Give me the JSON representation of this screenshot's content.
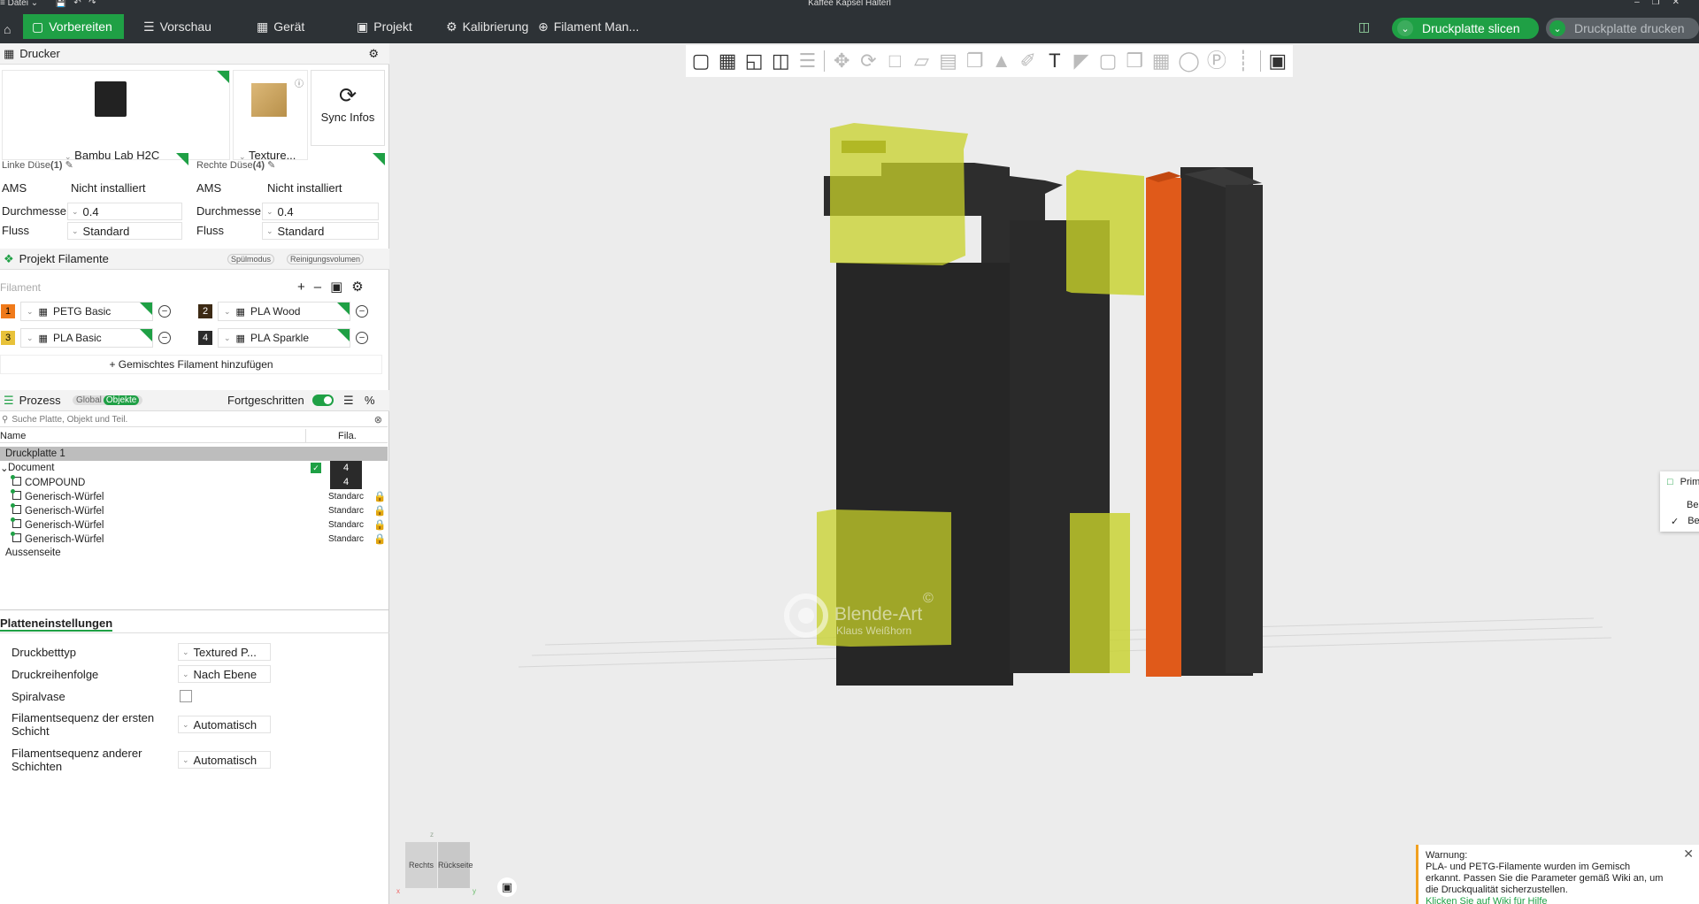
{
  "window": {
    "title": "Kaffee Kapsel Halterl",
    "menu_label": "Datei"
  },
  "topbar": {
    "tabs": [
      {
        "label": "Vorbereiten"
      },
      {
        "label": "Vorschau"
      },
      {
        "label": "Gerät"
      },
      {
        "label": "Projekt"
      },
      {
        "label": "Kalibrierung"
      },
      {
        "label": "Filament Man..."
      }
    ],
    "slice_label": "Druckplatte slicen",
    "print_label": "Druckplatte drucken"
  },
  "printer": {
    "section_title": "Drucker",
    "printer_name": "Bambu Lab H2C",
    "plate_name": "Texture...",
    "sync_label": "Sync Infos",
    "left_nozzle": {
      "title": "Linke Düse",
      "count": "(1)",
      "ams_label": "AMS",
      "ams_value": "Nicht installiert",
      "diameter_label": "Durchmesse",
      "diameter_value": "0.4",
      "flow_label": "Fluss",
      "flow_value": "Standard"
    },
    "right_nozzle": {
      "title": "Rechte Düse",
      "count": "(4)",
      "ams_label": "AMS",
      "ams_value": "Nicht installiert",
      "diameter_label": "Durchmesse",
      "diameter_value": "0.4",
      "flow_label": "Fluss",
      "flow_value": "Standard"
    }
  },
  "filaments": {
    "section_title": "Projekt Filamente",
    "flush_mode": "Spülmodus",
    "cleaning_volume": "Reinigungsvolumen",
    "filament_label": "Filament",
    "items": [
      {
        "num": "1",
        "name": "PETG Basic",
        "color": "#f07a1a",
        "text_color": "#000000"
      },
      {
        "num": "2",
        "name": "PLA Wood",
        "color": "#3d2a14",
        "text_color": "#ffffff"
      },
      {
        "num": "3",
        "name": "PLA Basic",
        "color": "#e8c23a",
        "text_color": "#000000"
      },
      {
        "num": "4",
        "name": "PLA Sparkle",
        "color": "#2a2a2a",
        "text_color": "#ffffff"
      }
    ],
    "add_mixed": "Gemischtes Filament hinzufügen"
  },
  "process": {
    "section_title": "Prozess",
    "global_label": "Global",
    "objects_label": "Objekte",
    "advanced_label": "Fortgeschritten",
    "search_placeholder": "Suche Platte, Objekt und Teil.",
    "col_name": "Name",
    "col_fila": "Fila.",
    "plate_row": "Druckplatte 1",
    "document_row": "Document",
    "document_fila": "4",
    "compound_row": "COMPOUND",
    "compound_fila": "4",
    "cubes": [
      {
        "name": "Generisch-Würfel",
        "fila": "Standarc"
      },
      {
        "name": "Generisch-Würfel",
        "fila": "Standarc"
      },
      {
        "name": "Generisch-Würfel",
        "fila": "Standarc"
      },
      {
        "name": "Generisch-Würfel",
        "fila": "Standarc"
      }
    ],
    "outside_row": "Aussenseite"
  },
  "plate_settings": {
    "section_title": "Platteneinstellungen",
    "rows": [
      {
        "label": "Druckbetttyp",
        "value": "Textured P..."
      },
      {
        "label": "Druckreihenfolge",
        "value": "Nach Ebene"
      },
      {
        "label": "Spiralvase",
        "value": ""
      },
      {
        "label": "Filamentsequenz der ersten",
        "label2": "Schicht",
        "value": "Automatisch"
      },
      {
        "label": "Filamentsequenz anderer",
        "label2": "Schichten",
        "value": "Automatisch"
      }
    ]
  },
  "context_menu": {
    "add_primitive": "Primitiv hinzufügen",
    "labels_by_layer": "Beschriftungen nach Schicht anzeigen",
    "labels_by_object": "Beschriftungen nach Objekt anzeigen"
  },
  "watermark": {
    "brand": "Blende-Art",
    "author": "Klaus Weißhorn"
  },
  "view_cube": {
    "right": "Rechts",
    "back": "Rückseite",
    "z": "z",
    "x": "x",
    "y": "y"
  },
  "warning": {
    "title": "Warnung:",
    "line1": "PLA- und PETG-Filamente wurden im Gemisch",
    "line2": "erkannt. Passen Sie die Parameter gemäß Wiki an, um",
    "line3": "die Druckqualität sicherzustellen.",
    "link": "Klicken Sie auf Wiki für Hilfe"
  },
  "colors": {
    "accent": "#1fa045",
    "topbar": "#2d3236",
    "orange": "#e05a1a",
    "yellow_transparent": "#c8d22a"
  }
}
